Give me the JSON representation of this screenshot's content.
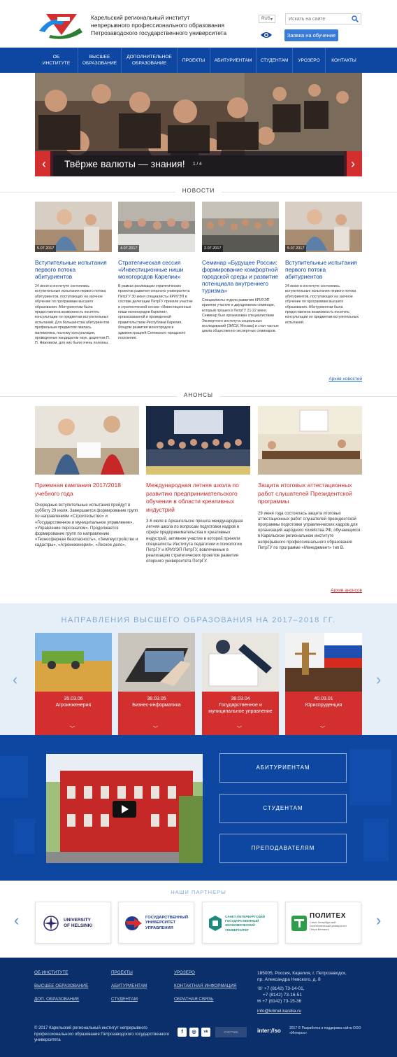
{
  "header": {
    "org_name_lines": [
      "Карельский региональный институт",
      "непрерывного профессионального образования",
      "Петрозаводского государственного университета"
    ],
    "lang": "RUS",
    "search_placeholder": "Искать на сайте",
    "apply_button": "Заявка на обучение"
  },
  "nav": {
    "items": [
      "Об институте",
      "Высшее образование",
      "Дополнительное образование",
      "Проекты",
      "Абитуриентам",
      "Студентам",
      "Урозеро",
      "Контакты"
    ]
  },
  "slider": {
    "caption": "Твёрже валюты — знания!",
    "counter": "1 / 4"
  },
  "news": {
    "title": "НОВОСТИ",
    "archive": "Архив новостей",
    "items": [
      {
        "date": "5.07.2017",
        "title": "Вступительные испытания первого потока абитуриентов",
        "text": "24 июня в институте состоялись вступительные испытания первого потока абитуриентов, поступающих на заочное обучение по программам высшего образования. Абитуриентам была предоставлена возможность посетить консультации по предметам вступительных испытаний. Для большинства абитуриентов профильным предметом явилась математика, поэтому консультации, проведенные кандидатом наук, доцентом П. П. Нижником, для них были очень полезны."
      },
      {
        "date": "4.07.2017",
        "title": "Стратегическая сессия «Инвестиционные ниши моногородов Карелии»",
        "text": "В рамках реализации стратегических проектов развития опорного университета ПетрГУ 30 июня специалисты КРИУЭП в составе делегации ПетрГУ приняли участие в стратегической сессии «Инвестиционные ниши моногородов Карелии», организованной и проведенной правительством Республики Карелия, Фондом развития моногородов и администрацией Сегежского городского поселения."
      },
      {
        "date": "2.07.2017",
        "title": "Семинар «Будущее России: формирование комфортной городской среды и развитие потенциала внутреннего туризма»",
        "text": "Специалисты отдела развития КРИУЭП приняли участие в двухдневном семинаре, который прошел в ПетрГУ 21-22 июня. Семинар был организован специалистами Экспертного института социальных исследований (ЭИСИ, Москва) и стал частью цикла общественно-экспертных семинаров."
      },
      {
        "date": "5.07.2017",
        "title": "Вступительные испытания первого потока абитуриентов",
        "text": "24 июня в институте состоялись вступительные испытания первого потока абитуриентов, поступающих на заочное обучение по программам высшего образования. Абитуриентам была предоставлена возможность посетить консультации по предметам вступительных испытаний."
      }
    ]
  },
  "announcements": {
    "title": "АНОНСЫ",
    "archive": "Архив анонсов",
    "items": [
      {
        "title": "Приемная кампания 2017/2018 учебного года",
        "text": "Очередные вступительные испытания пройдут в субботу 29 июля. Завершается формирование групп по направлениям «Строительство» и «Государственное и муниципальное управление», «Управление персоналом». Продолжается формирование групп по направлению «Техносферная безопасность», «Землеустройство и кадастры», «Агроинженерия», «Лесное дело»."
      },
      {
        "title": "Международная летняя школа по развитию предпринимательского обучения в области креативных индустрий",
        "text": "3-6 июля в Архангельске прошла международная летняя школа по вопросам подготовки кадров в сфере предпринимательства и креативных индустрий, активное участие в которой приняли специалисты Института педагогики и психологии ПетрГУ и КРИУЭП ПетрГУ, вовлеченные в реализацию стратегических проектов развития опорного университета ПетрГУ."
      },
      {
        "title": "Защита итоговых аттестационных работ слушателей Президентской программы",
        "text": "29 июня года состоялась защита итоговых аттестационных работ слушателей президентской программы подготовки управленческих кадров для организаций народного хозяйства РФ, обучающихся в Карельском региональном институте непрерывного профессионального образования ПетрГУ по программе «Менеджмент» тип В."
      }
    ]
  },
  "directions": {
    "title": "НАПРАВЛЕНИЯ ВЫСШЕГО ОБРАЗОВАНИЯ НА 2017–2018 ГГ.",
    "items": [
      {
        "code": "35.03.06",
        "name": "Агроинженерия"
      },
      {
        "code": "38.03.05",
        "name": "Бизнес-информатика"
      },
      {
        "code": "38.03.04",
        "name": "Государственное и муниципальное управление"
      },
      {
        "code": "40.03.01",
        "name": "Юриспруденция"
      }
    ]
  },
  "band": {
    "buttons": [
      "АБИТУРИЕНТАМ",
      "СТУДЕНТАМ",
      "ПРЕПОДАВАТЕЛЯМ"
    ]
  },
  "partners": {
    "title": "НАШИ ПАРТНЕРЫ",
    "items": [
      {
        "name_lines": [
          "UNIVERSITY",
          "OF HELSINKI"
        ]
      },
      {
        "name_lines": [
          "ГОСУДАРСТВЕННЫЙ",
          "УНИВЕРСИТЕТ",
          "УПРАВЛЕНИЯ"
        ]
      },
      {
        "name_lines": [
          "САНКТ-ПЕТЕРБУРГСКИЙ",
          "ГОСУДАРСТВЕННЫЙ",
          "ЭКОНОМИЧЕСКИЙ",
          "УНИВЕРСИТЕТ"
        ]
      },
      {
        "name": "ПОЛИТЕХ",
        "sub_lines": [
          "Санкт-Петербургский",
          "политехнический университет",
          "Петра Великого"
        ]
      }
    ]
  },
  "footer": {
    "col1": [
      "Об институте",
      "Высшее образование",
      "Доп. образование"
    ],
    "col2": [
      "Проекты",
      "Абитуриентам",
      "Студентам"
    ],
    "col3": [
      "Урозеро",
      "Контактная информация",
      "Обратная связь"
    ],
    "address": [
      "185005, Россия, Карелия, г. Петрозаводск,",
      "пр. Александра Невского, д. 8"
    ],
    "phones": [
      "+7 (8142) 73-14-01,",
      "+7 (8142) 73-16-51",
      "+7 (8142) 73-15-36"
    ],
    "email": "info@krimel.karelia.ru",
    "copyright": "© 2017 Карельский региональный институт непрерывного профессионального образования Петрозаводского государственного университета",
    "social": [
      "f",
      "◎",
      "vk"
    ],
    "counter": "СЧЕТЧИК",
    "dev_logo": "inter://so",
    "dev_text": "2017 © Разработка и поддержка сайта ООО «Интерсо»"
  }
}
